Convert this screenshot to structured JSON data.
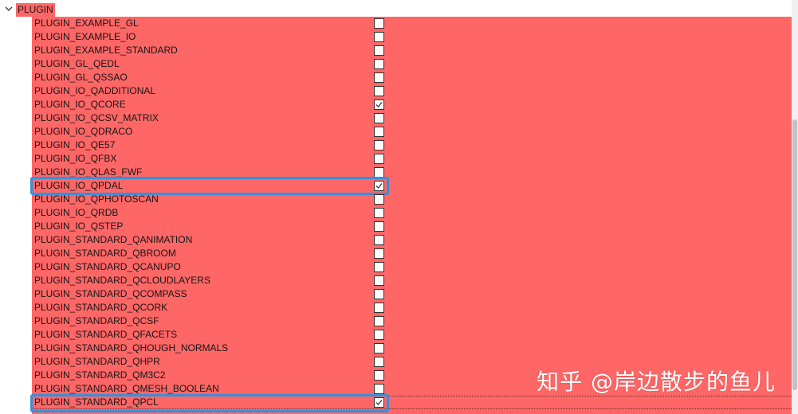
{
  "tree": {
    "group": {
      "label": "PLUGIN",
      "icon": "chevron-down-icon"
    },
    "items": [
      {
        "label": "PLUGIN_EXAMPLE_GL",
        "checked": false
      },
      {
        "label": "PLUGIN_EXAMPLE_IO",
        "checked": false
      },
      {
        "label": "PLUGIN_EXAMPLE_STANDARD",
        "checked": false
      },
      {
        "label": "PLUGIN_GL_QEDL",
        "checked": false
      },
      {
        "label": "PLUGIN_GL_QSSAO",
        "checked": false
      },
      {
        "label": "PLUGIN_IO_QADDITIONAL",
        "checked": false
      },
      {
        "label": "PLUGIN_IO_QCORE",
        "checked": true
      },
      {
        "label": "PLUGIN_IO_QCSV_MATRIX",
        "checked": false
      },
      {
        "label": "PLUGIN_IO_QDRACO",
        "checked": false
      },
      {
        "label": "PLUGIN_IO_QE57",
        "checked": false
      },
      {
        "label": "PLUGIN_IO_QFBX",
        "checked": false
      },
      {
        "label": "PLUGIN_IO_QLAS_FWF",
        "checked": false
      },
      {
        "label": "PLUGIN_IO_QPDAL",
        "checked": true,
        "highlighted": true
      },
      {
        "label": "PLUGIN_IO_QPHOTOSCAN",
        "checked": false
      },
      {
        "label": "PLUGIN_IO_QRDB",
        "checked": false
      },
      {
        "label": "PLUGIN_IO_QSTEP",
        "checked": false
      },
      {
        "label": "PLUGIN_STANDARD_QANIMATION",
        "checked": false
      },
      {
        "label": "PLUGIN_STANDARD_QBROOM",
        "checked": false
      },
      {
        "label": "PLUGIN_STANDARD_QCANUPO",
        "checked": false
      },
      {
        "label": "PLUGIN_STANDARD_QCLOUDLAYERS",
        "checked": false
      },
      {
        "label": "PLUGIN_STANDARD_QCOMPASS",
        "checked": false
      },
      {
        "label": "PLUGIN_STANDARD_QCORK",
        "checked": false
      },
      {
        "label": "PLUGIN_STANDARD_QCSF",
        "checked": false
      },
      {
        "label": "PLUGIN_STANDARD_QFACETS",
        "checked": false
      },
      {
        "label": "PLUGIN_STANDARD_QHOUGH_NORMALS",
        "checked": false
      },
      {
        "label": "PLUGIN_STANDARD_QHPR",
        "checked": false
      },
      {
        "label": "PLUGIN_STANDARD_QM3C2",
        "checked": false
      },
      {
        "label": "PLUGIN_STANDARD_QMESH_BOOLEAN",
        "checked": false
      },
      {
        "label": "PLUGIN_STANDARD_QPCL",
        "checked": true,
        "highlighted": true
      }
    ]
  },
  "watermark": "知乎 @岸边散步的鱼儿",
  "colors": {
    "row_background": "#ff6666",
    "highlight_border": "#3a8fd8",
    "checkbox_border": "#333333"
  }
}
